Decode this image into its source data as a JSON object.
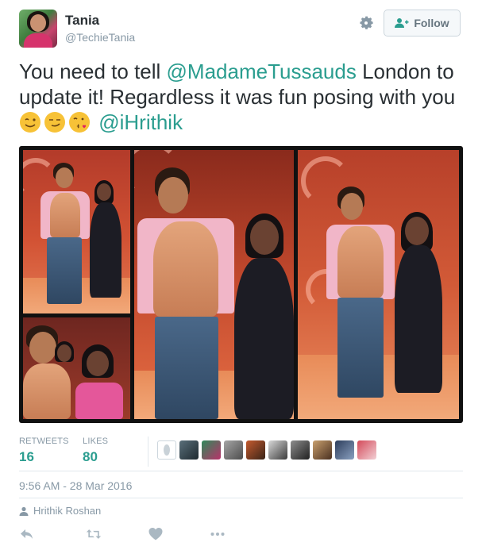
{
  "user": {
    "name": "Tania",
    "handle": "@TechieTania",
    "avatar_icon": "profile-photo"
  },
  "header": {
    "settings_icon": "gear-icon",
    "follow_label": "Follow",
    "follow_icon": "add-user-icon"
  },
  "tweet": {
    "text_part1": "You need to tell ",
    "mention1": "@MadameTussauds",
    "text_part2": " London to update it! Regardless it was fun posing with you ",
    "emojis": [
      "winking-face",
      "smirking-face",
      "face-blowing-kiss"
    ],
    "mention2": "@iHrithik"
  },
  "photos": {
    "count": 4,
    "description_icons": [
      "wax-figure-photo",
      "wax-figure-photo",
      "wax-figure-photo",
      "wax-figure-photo"
    ]
  },
  "stats": {
    "retweets_label": "RETWEETS",
    "retweets_value": "16",
    "likes_label": "LIKES",
    "likes_value": "80"
  },
  "likers": {
    "count_shown": 10
  },
  "timestamp": "9:56 AM - 28 Mar 2016",
  "context": {
    "icon": "person-icon",
    "label": "Hrithik Roshan"
  },
  "actions": {
    "reply_icon": "reply-icon",
    "retweet_icon": "retweet-icon",
    "like_icon": "heart-icon",
    "more_icon": "more-icon"
  },
  "colors": {
    "accent": "#2a9d8f",
    "muted": "#8899a6",
    "text": "#292f33",
    "border": "#e1e8ed"
  }
}
